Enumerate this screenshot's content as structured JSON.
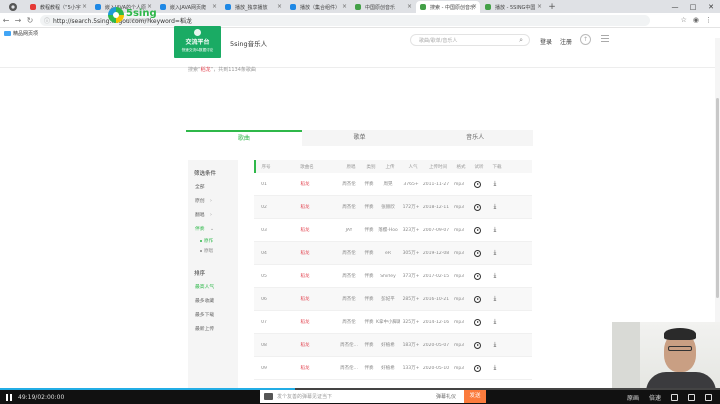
{
  "browser": {
    "tabs": [
      {
        "label": "教程教程（“5小字",
        "color": "#e53935",
        "active": false
      },
      {
        "label": "嵌入JAVA的个人原",
        "color": "#1e88e5",
        "active": false
      },
      {
        "label": "嵌入JAVA网页爬",
        "color": "#1e88e5",
        "active": false
      },
      {
        "label": "播放_独享播放",
        "color": "#1e88e5",
        "active": false
      },
      {
        "label": "播放（集合组件）",
        "color": "#1e88e5",
        "active": false
      },
      {
        "label": "中国原创音乐",
        "color": "#43a047",
        "active": false
      },
      {
        "label": "搜索 - 中国原创音乐",
        "color": "#43a047",
        "active": true
      },
      {
        "label": "播放 - 5SING中国",
        "color": "#43a047",
        "active": false
      }
    ],
    "url": "http://search.5sing.kugou.com/?keyword=稻龙",
    "bookmark": "精品网页项"
  },
  "header": {
    "logo_word": "5sing",
    "logo_sub": "中国原创音乐基地",
    "promo_title": "交流平台",
    "promo_sub": "快速交流&数据讨论",
    "site_name": "5sing音乐人",
    "search_placeholder": "歌曲/歌单/音乐人",
    "login": "登录",
    "register": "注册"
  },
  "results": {
    "prefix": "搜索“",
    "keyword": "稻龙",
    "suffix": "”，共到1134条歌曲"
  },
  "search_tabs": [
    "歌曲",
    "歌单",
    "音乐人"
  ],
  "filter": {
    "title": "筛选条件",
    "items": [
      "全部",
      "原创",
      "翻唱",
      "伴奏"
    ],
    "sub_items": [
      "原作",
      "原唱"
    ],
    "sort_title": "排序",
    "sort_items": [
      "最高人气",
      "最多收藏",
      "最多下载",
      "最新上传"
    ]
  },
  "table": {
    "headers": [
      "序号",
      "歌曲名",
      "原唱",
      "类别",
      "上传",
      "人气",
      "上传时间",
      "格式",
      "试听",
      "下载"
    ],
    "rows": [
      {
        "idx": "01",
        "song": "稻龙",
        "singer": "周杰伦",
        "type": "伴奏",
        "uploader": "周晃",
        "hits": "3765+",
        "date": "2011-11-27",
        "fmt": "mp3"
      },
      {
        "idx": "02",
        "song": "稻龙",
        "singer": "周杰伦",
        "type": "伴奏",
        "uploader": "张赫欣",
        "hits": "172万+",
        "date": "2018-12-11",
        "fmt": "mp3"
      },
      {
        "idx": "03",
        "song": "稻龙",
        "singer": "JAY",
        "type": "伴奏",
        "uploader": "落樱-Hoo",
        "hits": "323万+",
        "date": "2007-09-07",
        "fmt": "mp3"
      },
      {
        "idx": "04",
        "song": "稻龙",
        "singer": "周杰伦",
        "type": "伴奏",
        "uploader": "eR",
        "hits": "305万+",
        "date": "2019-12-08",
        "fmt": "mp3"
      },
      {
        "idx": "05",
        "song": "稻龙",
        "singer": "周杰伦",
        "type": "伴奏",
        "uploader": "Shirley",
        "hits": "373万+",
        "date": "2017-02-15",
        "fmt": "mp3"
      },
      {
        "idx": "06",
        "song": "稻龙",
        "singer": "周杰伦",
        "type": "伴奏",
        "uploader": "彭妃平",
        "hits": "285万+",
        "date": "2016-10-21",
        "fmt": "mp3"
      },
      {
        "idx": "07",
        "song": "稻龙",
        "singer": "周杰伦",
        "type": "伴奏",
        "uploader": "K拿中小脚踢",
        "hits": "325万+",
        "date": "2014-12-16",
        "fmt": "mp3"
      },
      {
        "idx": "08",
        "song": "稻龙",
        "singer": "周杰伦...",
        "type": "伴奏",
        "uploader": "好植希",
        "hits": "183万+",
        "date": "2020-05-07",
        "fmt": "mp3"
      },
      {
        "idx": "09",
        "song": "稻龙",
        "singer": "周杰伦...",
        "type": "伴奏",
        "uploader": "好植希",
        "hits": "133万+",
        "date": "2020-05-10",
        "fmt": "mp3"
      }
    ]
  },
  "player": {
    "time": "49:19/02:00:00",
    "progress": 0.41,
    "danmaku_placeholder": "发个友善的弹幕见证当下",
    "danmaku_etiquette": "弹幕礼仪",
    "send": "发送",
    "quality": "原画",
    "speed": "倍速"
  },
  "colors": {
    "accent": "#2fb84a",
    "song": "#e2424e",
    "send": "#fb7b3d",
    "progress": "#23ade5"
  }
}
